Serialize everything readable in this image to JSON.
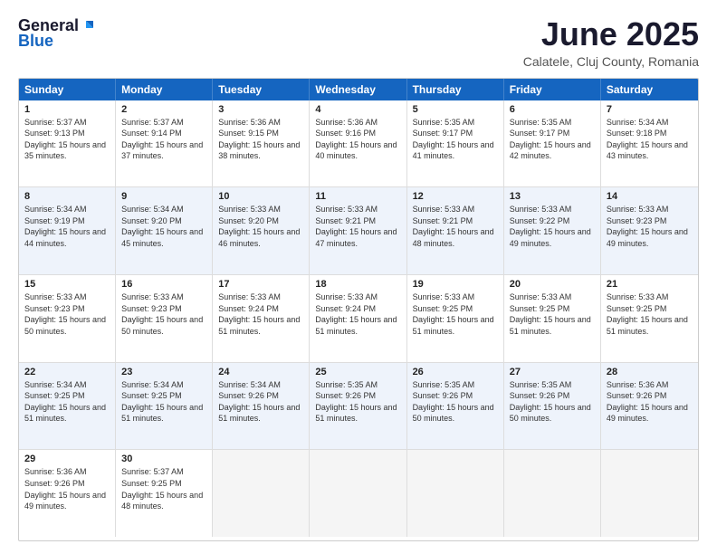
{
  "header": {
    "logo_general": "General",
    "logo_blue": "Blue",
    "title": "June 2025",
    "location": "Calatele, Cluj County, Romania"
  },
  "calendar": {
    "days_of_week": [
      "Sunday",
      "Monday",
      "Tuesday",
      "Wednesday",
      "Thursday",
      "Friday",
      "Saturday"
    ],
    "rows": [
      [
        {
          "day": "",
          "empty": true
        },
        {
          "day": "",
          "empty": true
        },
        {
          "day": "",
          "empty": true
        },
        {
          "day": "",
          "empty": true
        },
        {
          "day": "",
          "empty": true
        },
        {
          "day": "",
          "empty": true
        },
        {
          "day": "",
          "empty": true
        }
      ]
    ],
    "cells": [
      [
        {
          "day": null,
          "content": ""
        },
        {
          "day": null,
          "content": ""
        },
        {
          "day": null,
          "content": ""
        },
        {
          "day": null,
          "content": ""
        },
        {
          "day": null,
          "content": ""
        },
        {
          "day": null,
          "content": ""
        },
        {
          "day": null,
          "content": ""
        }
      ]
    ]
  },
  "weeks": [
    {
      "alt": false,
      "cells": [
        {
          "day": "1",
          "sunrise": "Sunrise: 5:37 AM",
          "sunset": "Sunset: 9:13 PM",
          "daylight": "Daylight: 15 hours and 35 minutes."
        },
        {
          "day": "2",
          "sunrise": "Sunrise: 5:37 AM",
          "sunset": "Sunset: 9:14 PM",
          "daylight": "Daylight: 15 hours and 37 minutes."
        },
        {
          "day": "3",
          "sunrise": "Sunrise: 5:36 AM",
          "sunset": "Sunset: 9:15 PM",
          "daylight": "Daylight: 15 hours and 38 minutes."
        },
        {
          "day": "4",
          "sunrise": "Sunrise: 5:36 AM",
          "sunset": "Sunset: 9:16 PM",
          "daylight": "Daylight: 15 hours and 40 minutes."
        },
        {
          "day": "5",
          "sunrise": "Sunrise: 5:35 AM",
          "sunset": "Sunset: 9:17 PM",
          "daylight": "Daylight: 15 hours and 41 minutes."
        },
        {
          "day": "6",
          "sunrise": "Sunrise: 5:35 AM",
          "sunset": "Sunset: 9:17 PM",
          "daylight": "Daylight: 15 hours and 42 minutes."
        },
        {
          "day": "7",
          "sunrise": "Sunrise: 5:34 AM",
          "sunset": "Sunset: 9:18 PM",
          "daylight": "Daylight: 15 hours and 43 minutes."
        }
      ]
    },
    {
      "alt": true,
      "cells": [
        {
          "day": "8",
          "sunrise": "Sunrise: 5:34 AM",
          "sunset": "Sunset: 9:19 PM",
          "daylight": "Daylight: 15 hours and 44 minutes."
        },
        {
          "day": "9",
          "sunrise": "Sunrise: 5:34 AM",
          "sunset": "Sunset: 9:20 PM",
          "daylight": "Daylight: 15 hours and 45 minutes."
        },
        {
          "day": "10",
          "sunrise": "Sunrise: 5:33 AM",
          "sunset": "Sunset: 9:20 PM",
          "daylight": "Daylight: 15 hours and 46 minutes."
        },
        {
          "day": "11",
          "sunrise": "Sunrise: 5:33 AM",
          "sunset": "Sunset: 9:21 PM",
          "daylight": "Daylight: 15 hours and 47 minutes."
        },
        {
          "day": "12",
          "sunrise": "Sunrise: 5:33 AM",
          "sunset": "Sunset: 9:21 PM",
          "daylight": "Daylight: 15 hours and 48 minutes."
        },
        {
          "day": "13",
          "sunrise": "Sunrise: 5:33 AM",
          "sunset": "Sunset: 9:22 PM",
          "daylight": "Daylight: 15 hours and 49 minutes."
        },
        {
          "day": "14",
          "sunrise": "Sunrise: 5:33 AM",
          "sunset": "Sunset: 9:23 PM",
          "daylight": "Daylight: 15 hours and 49 minutes."
        }
      ]
    },
    {
      "alt": false,
      "cells": [
        {
          "day": "15",
          "sunrise": "Sunrise: 5:33 AM",
          "sunset": "Sunset: 9:23 PM",
          "daylight": "Daylight: 15 hours and 50 minutes."
        },
        {
          "day": "16",
          "sunrise": "Sunrise: 5:33 AM",
          "sunset": "Sunset: 9:23 PM",
          "daylight": "Daylight: 15 hours and 50 minutes."
        },
        {
          "day": "17",
          "sunrise": "Sunrise: 5:33 AM",
          "sunset": "Sunset: 9:24 PM",
          "daylight": "Daylight: 15 hours and 51 minutes."
        },
        {
          "day": "18",
          "sunrise": "Sunrise: 5:33 AM",
          "sunset": "Sunset: 9:24 PM",
          "daylight": "Daylight: 15 hours and 51 minutes."
        },
        {
          "day": "19",
          "sunrise": "Sunrise: 5:33 AM",
          "sunset": "Sunset: 9:25 PM",
          "daylight": "Daylight: 15 hours and 51 minutes."
        },
        {
          "day": "20",
          "sunrise": "Sunrise: 5:33 AM",
          "sunset": "Sunset: 9:25 PM",
          "daylight": "Daylight: 15 hours and 51 minutes."
        },
        {
          "day": "21",
          "sunrise": "Sunrise: 5:33 AM",
          "sunset": "Sunset: 9:25 PM",
          "daylight": "Daylight: 15 hours and 51 minutes."
        }
      ]
    },
    {
      "alt": true,
      "cells": [
        {
          "day": "22",
          "sunrise": "Sunrise: 5:34 AM",
          "sunset": "Sunset: 9:25 PM",
          "daylight": "Daylight: 15 hours and 51 minutes."
        },
        {
          "day": "23",
          "sunrise": "Sunrise: 5:34 AM",
          "sunset": "Sunset: 9:25 PM",
          "daylight": "Daylight: 15 hours and 51 minutes."
        },
        {
          "day": "24",
          "sunrise": "Sunrise: 5:34 AM",
          "sunset": "Sunset: 9:26 PM",
          "daylight": "Daylight: 15 hours and 51 minutes."
        },
        {
          "day": "25",
          "sunrise": "Sunrise: 5:35 AM",
          "sunset": "Sunset: 9:26 PM",
          "daylight": "Daylight: 15 hours and 51 minutes."
        },
        {
          "day": "26",
          "sunrise": "Sunrise: 5:35 AM",
          "sunset": "Sunset: 9:26 PM",
          "daylight": "Daylight: 15 hours and 50 minutes."
        },
        {
          "day": "27",
          "sunrise": "Sunrise: 5:35 AM",
          "sunset": "Sunset: 9:26 PM",
          "daylight": "Daylight: 15 hours and 50 minutes."
        },
        {
          "day": "28",
          "sunrise": "Sunrise: 5:36 AM",
          "sunset": "Sunset: 9:26 PM",
          "daylight": "Daylight: 15 hours and 49 minutes."
        }
      ]
    },
    {
      "alt": false,
      "cells": [
        {
          "day": "29",
          "sunrise": "Sunrise: 5:36 AM",
          "sunset": "Sunset: 9:26 PM",
          "daylight": "Daylight: 15 hours and 49 minutes."
        },
        {
          "day": "30",
          "sunrise": "Sunrise: 5:37 AM",
          "sunset": "Sunset: 9:25 PM",
          "daylight": "Daylight: 15 hours and 48 minutes."
        },
        {
          "day": null,
          "sunrise": "",
          "sunset": "",
          "daylight": ""
        },
        {
          "day": null,
          "sunrise": "",
          "sunset": "",
          "daylight": ""
        },
        {
          "day": null,
          "sunrise": "",
          "sunset": "",
          "daylight": ""
        },
        {
          "day": null,
          "sunrise": "",
          "sunset": "",
          "daylight": ""
        },
        {
          "day": null,
          "sunrise": "",
          "sunset": "",
          "daylight": ""
        }
      ]
    }
  ],
  "days_of_week": [
    "Sunday",
    "Monday",
    "Tuesday",
    "Wednesday",
    "Thursday",
    "Friday",
    "Saturday"
  ]
}
